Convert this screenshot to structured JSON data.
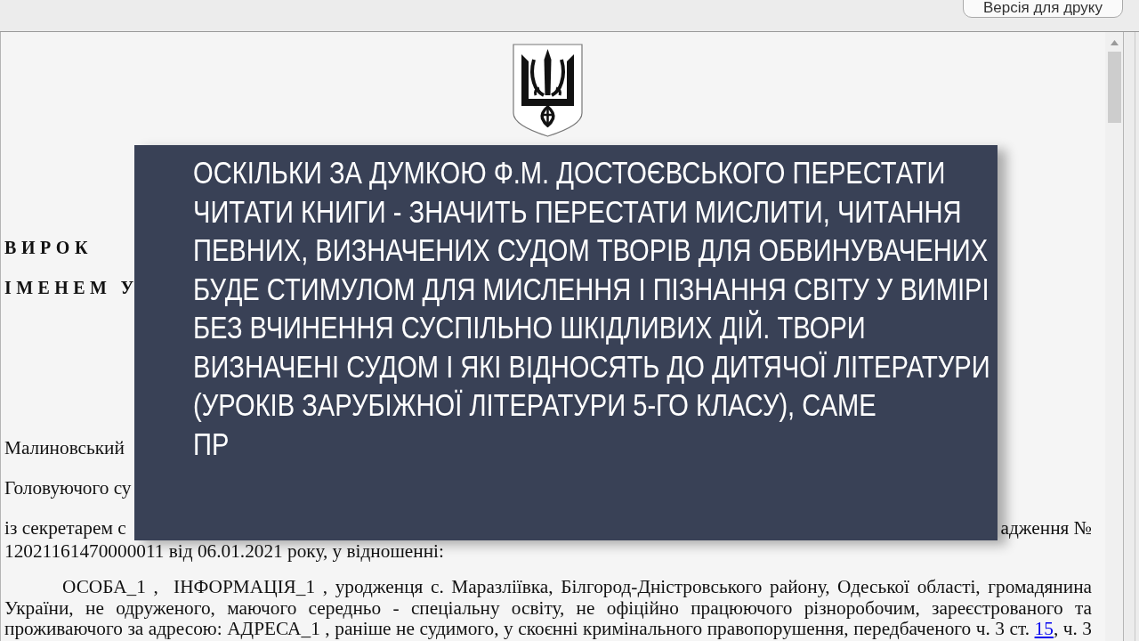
{
  "toolbar": {
    "print_button": "Версія для друку"
  },
  "document": {
    "title": "ВИРОК",
    "subtitle": "ІМЕНЕМ У",
    "paragraphs": [
      {
        "kind": "plain",
        "text": "Малиновський"
      },
      {
        "kind": "plain",
        "text": "Головуючого су"
      },
      {
        "kind": "split",
        "left": "із секретарем с",
        "right": "адження №",
        "text": "12021161470000011 від 06.01.2021 року, у відношенні:"
      },
      {
        "kind": "indented",
        "text": "ОСОБА_1 ,  ІНФОРМАЦІЯ_1 , уродженця с. Маразліївка, Білгород-Дністровського району, Одеської області, громадянина України, не одруженого, маючого середньо - спеціальну освіту, не офіційно працюючого різноробочим, зареєстрованого та проживаючого за адресою: АДРЕСА_1 , раніше не судимого, у скоєнні кримінального правопорушення, передбаченого ч. 3 ст. ",
        "link": "15",
        "text_after": ", ч. 3"
      }
    ]
  },
  "caption": {
    "text": "ОСКІЛЬКИ ЗА ДУМКОЮ Ф.М. ДОСТОЄВСЬКОГО ПЕРЕСТАТИ\nЧИТАТИ КНИГИ - ЗНАЧИТЬ ПЕРЕСТАТИ МИСЛИТИ, ЧИТАННЯ\nПЕВНИХ, ВИЗНАЧЕНИХ СУДОМ ТВОРІВ ДЛЯ ОБВИНУВАЧЕНИХ\nБУДЕ СТИМУЛОМ ДЛЯ МИСЛЕННЯ І ПІЗНАННЯ СВІТУ У ВИМІРІ\nБЕЗ ВЧИНЕННЯ СУСПІЛЬНО ШКІДЛИВИХ ДІЙ. ТВОРИ\nВИЗНАЧЕНІ СУДОМ І ЯКІ ВІДНОСЯТЬ ДО ДИТЯЧОЇ ЛІТЕРАТУРИ\n(УРОКІВ ЗАРУБІЖНОЇ ЛІТЕРАТУРИ 5-ГО КЛАСУ), САМЕ\nПР"
  }
}
